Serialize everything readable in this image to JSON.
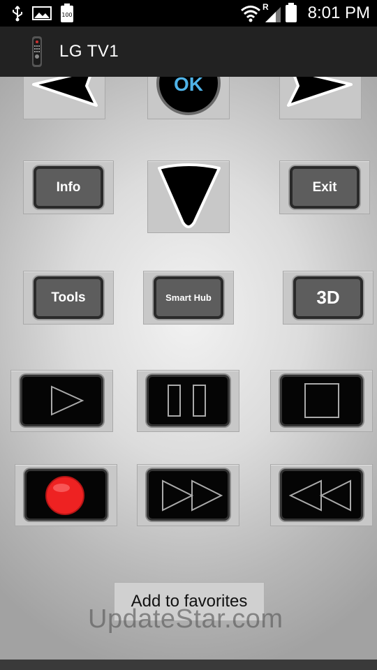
{
  "status_bar": {
    "time": "8:01 PM",
    "battery_level": "100",
    "icons": [
      "usb-icon",
      "image-icon",
      "battery-small-icon",
      "wifi-icon",
      "signal-icon",
      "battery-icon"
    ],
    "roaming_indicator": "R"
  },
  "action_bar": {
    "title": "LG TV1",
    "app_icon": "remote-control-icon"
  },
  "remote": {
    "ok_label": "OK",
    "info_label": "Info",
    "exit_label": "Exit",
    "tools_label": "Tools",
    "smart_hub_label": "Smart Hub",
    "three_d_label": "3D",
    "media_icons": [
      "play-icon",
      "pause-icon",
      "stop-icon",
      "record-icon",
      "fast-forward-icon",
      "rewind-icon"
    ],
    "nav_icons": [
      "left-arrow-icon",
      "right-arrow-icon",
      "down-arrow-icon"
    ]
  },
  "favorites_button_label": "Add to favorites",
  "watermark": "UpdateStar.com",
  "colors": {
    "record_red": "#ee2222",
    "ok_text_blue": "#4fb3e8",
    "status_bar_bg": "#000000",
    "action_bar_bg": "#222222"
  }
}
